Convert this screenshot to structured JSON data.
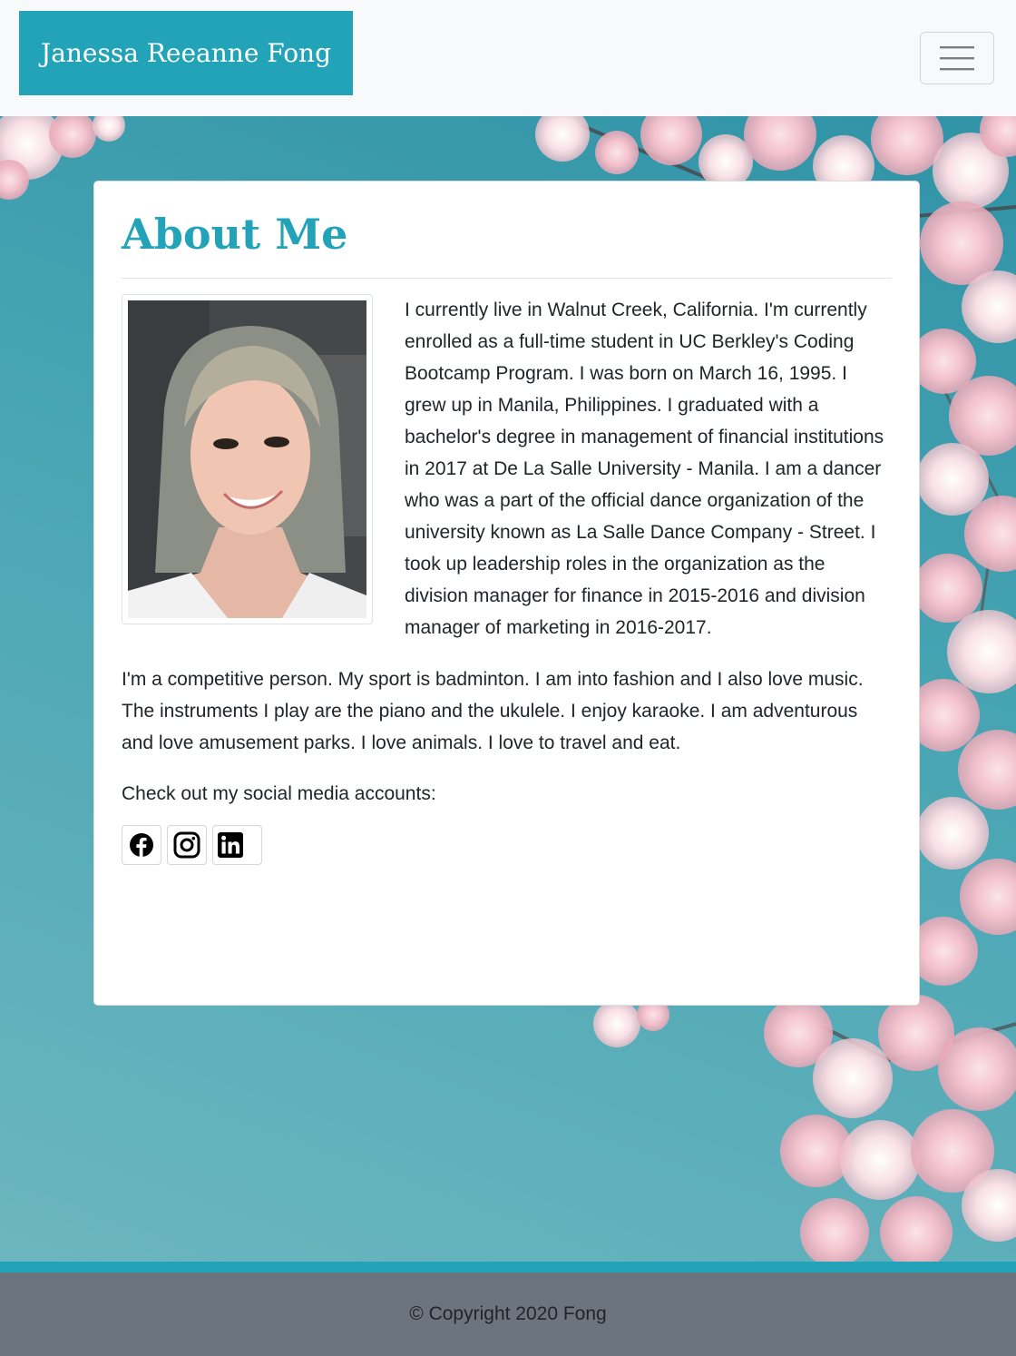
{
  "navbar": {
    "brand": "Janessa Reeanne Fong",
    "toggler_icon": "hamburger-icon"
  },
  "about": {
    "title": "About Me",
    "paragraph1": "I currently live in Walnut Creek, California. I'm currently enrolled as a full-time student in UC Berkley's Coding Bootcamp Program. I was born on March 16, 1995. I grew up in Manila, Philippines. I graduated with a bachelor's degree in management of financial institutions in 2017 at De La Salle University - Manila. I am a dancer who was a part of the official dance organization of the university known as La Salle Dance Company - Street. I took up leadership roles in the organization as the division manager for finance in 2015-2016 and division manager of marketing in 2016-2017.",
    "paragraph2": "I'm a competitive person. My sport is badminton. I am into fashion and I also love music. The instruments I play are the piano and the ukulele. I enjoy karaoke. I am adventurous and love amusement parks. I love animals. I love to travel and eat.",
    "social_label": "Check out my social media accounts:",
    "social_icons": [
      "facebook-icon",
      "instagram-icon",
      "linkedin-icon"
    ]
  },
  "footer": {
    "copyright": "© Copyright 2020 Fong"
  },
  "colors": {
    "accent": "#23a3b7",
    "footer_bg": "#6c757d",
    "navbar_bg": "#f8f9fa"
  }
}
